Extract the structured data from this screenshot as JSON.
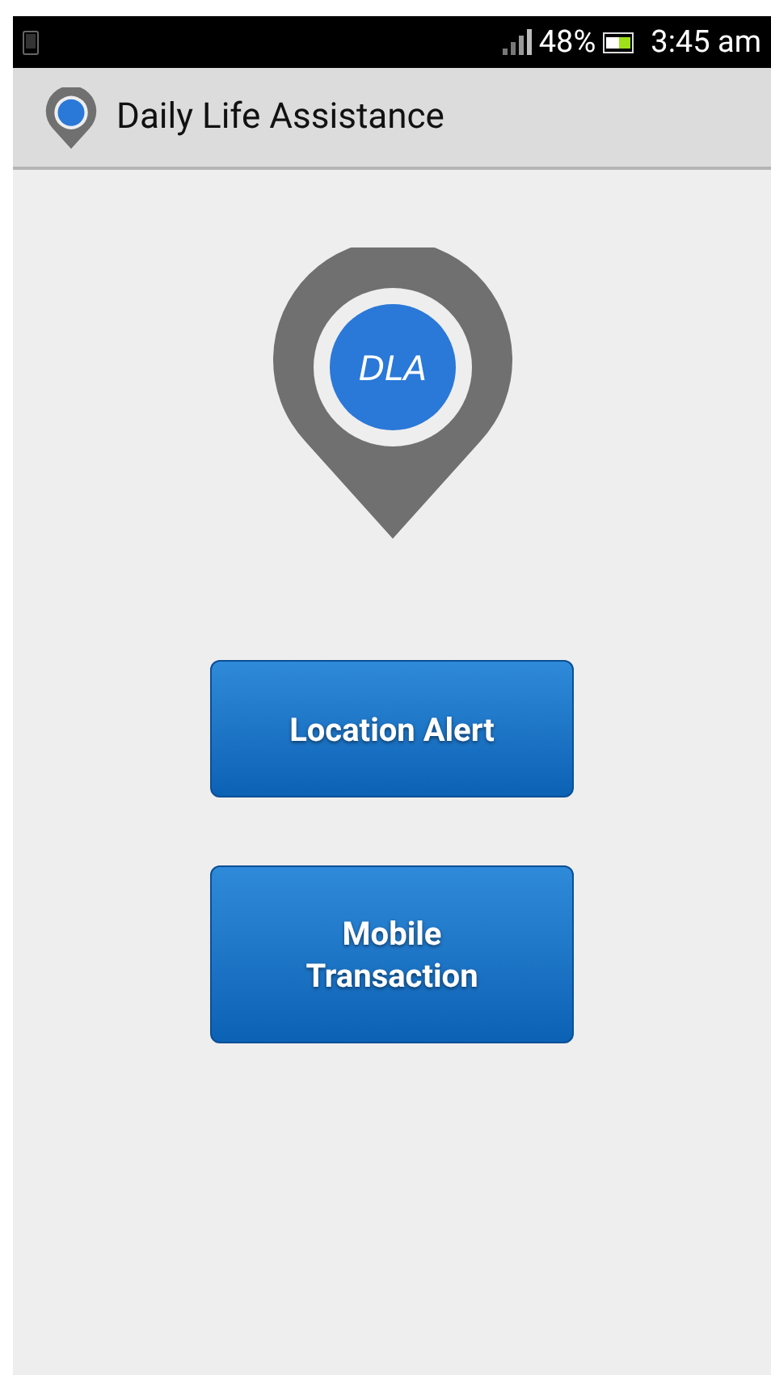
{
  "status_bar": {
    "battery": "48%",
    "time": "3:45 am"
  },
  "action_bar": {
    "title": "Daily Life Assistance"
  },
  "logo": {
    "text": "DLA"
  },
  "buttons": [
    {
      "label": "Location Alert"
    },
    {
      "label": "Mobile Transaction"
    }
  ]
}
